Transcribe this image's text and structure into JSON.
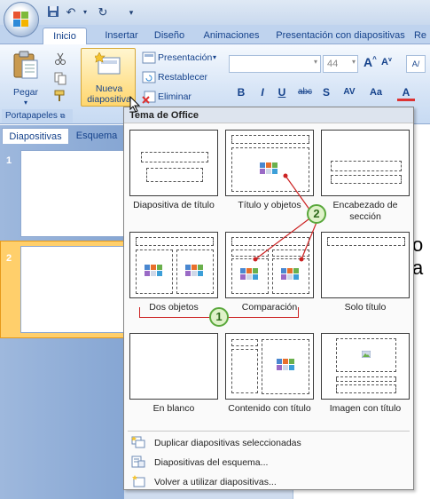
{
  "tabs": [
    "Inicio",
    "Insertar",
    "Diseño",
    "Animaciones",
    "Presentación con diapositivas",
    "Re"
  ],
  "ribbon": {
    "paste_label": "Pegar",
    "clipboard_group": "Portapapeles",
    "new_slide_line1": "Nueva",
    "new_slide_line2": "diapositiva",
    "layout_label": "Presentación",
    "reset_label": "Restablecer",
    "delete_label": "Eliminar",
    "font_size": "44",
    "format_buttons": [
      "B",
      "I",
      "U",
      "abc",
      "S",
      "AV",
      "Aa",
      "A"
    ]
  },
  "panel": {
    "tab_slides": "Diapositivas",
    "tab_outline": "Esquema",
    "slide_numbers": [
      "1",
      "2"
    ]
  },
  "dropdown": {
    "title": "Tema de Office",
    "layouts": [
      "Diapositiva de título",
      "Título y objetos",
      "Encabezado de sección",
      "Dos objetos",
      "Comparación",
      "Solo título",
      "En blanco",
      "Contenido con título",
      "Imagen con título"
    ],
    "commands": [
      "Duplicar diapositivas seleccionadas",
      "Diapositivas del esquema...",
      "Volver a utilizar diapositivas..."
    ]
  },
  "callouts": [
    "1",
    "2"
  ],
  "editor_fragment": "o a",
  "colors": {
    "callout_border": "#5aa83c",
    "callout_fill": "#dff2c9",
    "bracket_red": "#cc2222",
    "ribbon_blue": "#15428b"
  }
}
